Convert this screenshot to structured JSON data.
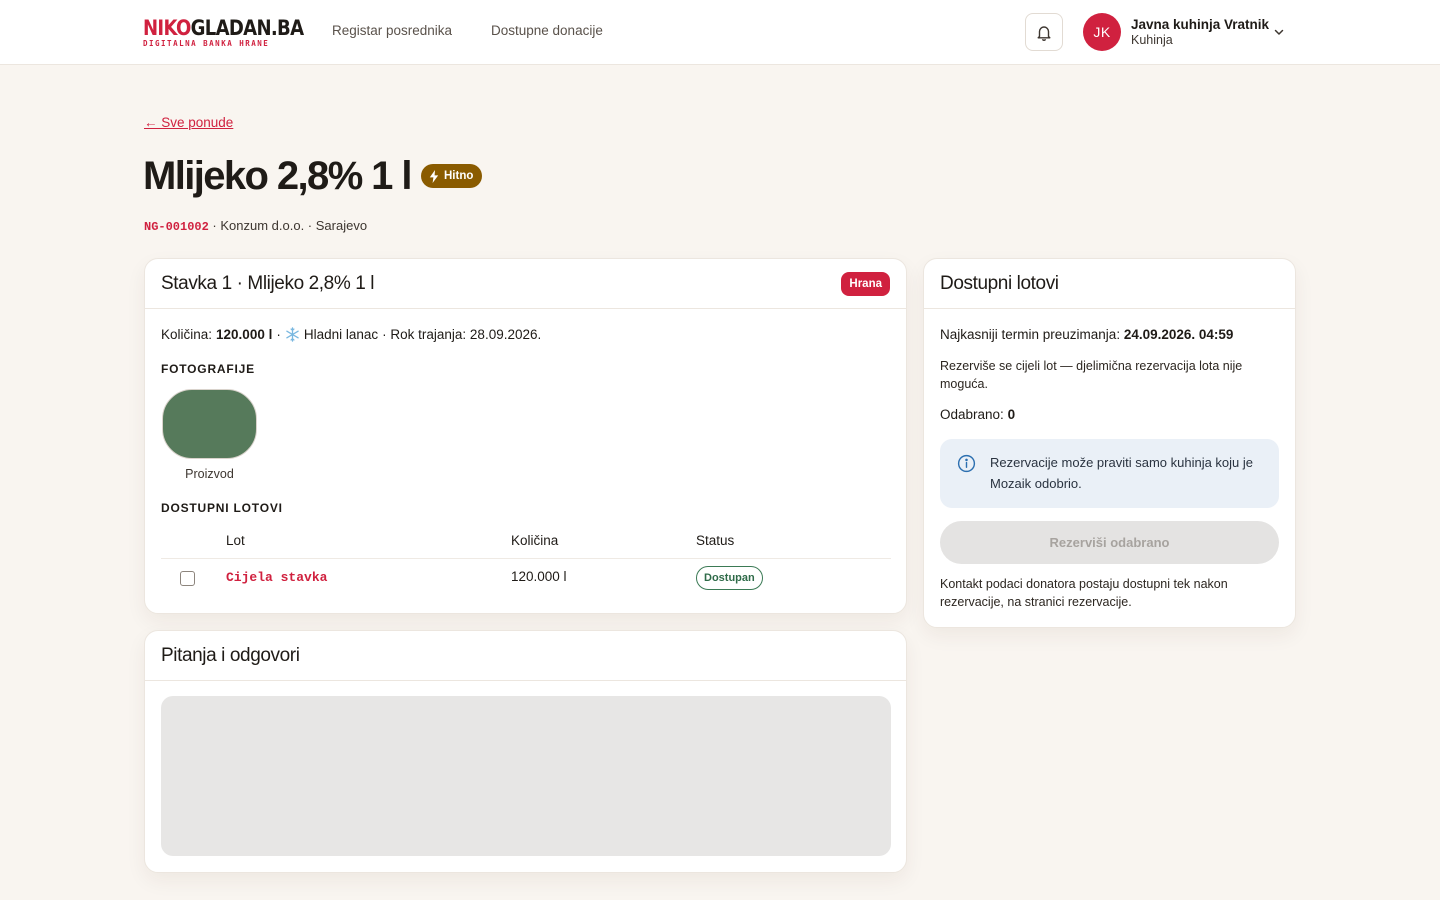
{
  "header": {
    "logo_part1": "NIKO",
    "logo_part2": "GLADAN.BA",
    "logo_tagline": "DIGITALNA BANKA HRANE",
    "nav": [
      "Registar posrednika",
      "Dostupne donacije"
    ],
    "user": {
      "initials": "JK",
      "name": "Javna kuhinja Vratnik",
      "role": "Kuhinja"
    }
  },
  "page": {
    "back_link": "← Sve ponude",
    "title": "Mlijeko 2,8% 1 l",
    "urgent_badge": "Hitno",
    "meta_code": "NG-001002",
    "meta_rest": " · Konzum d.o.o. · Sarajevo"
  },
  "item_card": {
    "title": "Stavka 1 · Mlijeko 2,8% 1 l",
    "category": "Hrana",
    "qty_label": "Količina:",
    "qty_value": "120.000 l",
    "cold_chain": "Hladni lanac",
    "expiry": "· Rok trajanja: 28.09.2026.",
    "photos_label": "FOTOGRAFIJE",
    "photo_caption": "Proizvod",
    "lots_label": "DOSTUPNI LOTOVI",
    "columns": [
      "Lot",
      "Količina",
      "Status"
    ],
    "lots": [
      {
        "name": "Cijela stavka",
        "qty": "120.000 l",
        "status": "Dostupan",
        "checked": false
      }
    ]
  },
  "qa_card": {
    "title": "Pitanja i odgovori"
  },
  "side_card": {
    "title": "Dostupni lotovi",
    "deadline_label": "Najkasniji termin preuzimanja:",
    "deadline_value": "24.09.2026. 04:59",
    "note": "Rezerviše se cijeli lot — djelimična rezervacija lota nije moguća.",
    "picked_label": "Odabrano:",
    "picked_value": "0",
    "info": "Rezervacije može praviti samo kuhinja koju je Mozaik odobrio.",
    "button": "Rezerviši odabrano",
    "contact_note": "Kontakt podaci donatora postaju dostupni tek nakon rezervacije, na stranici rezervacije."
  },
  "colors": {
    "brand_red": "#d0213f",
    "urgent": "#8a5b00",
    "status_green": "#2f6b49",
    "photo_swatch": "#567a5b"
  },
  "icons": [
    "bell-icon",
    "chevron-down-icon",
    "lightning-icon",
    "snowflake-icon",
    "info-icon"
  ]
}
